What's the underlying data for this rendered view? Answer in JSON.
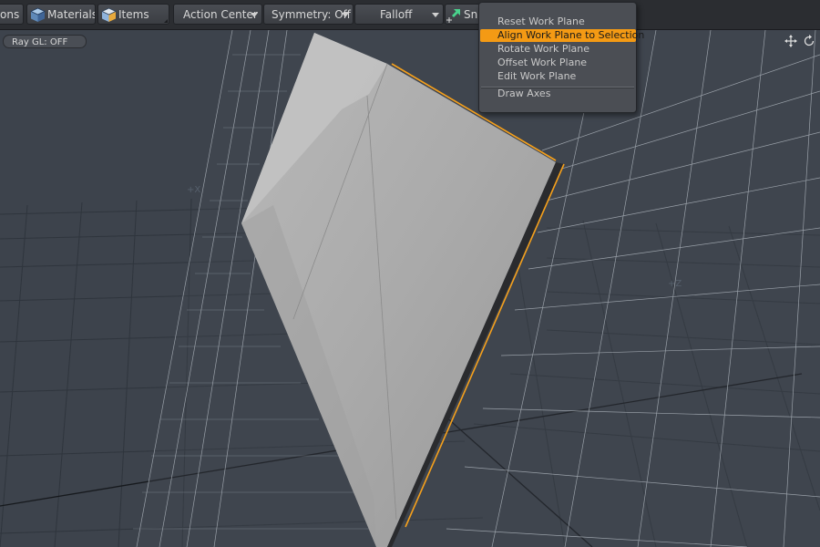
{
  "toolbar": {
    "tab_partial": "ons",
    "materials_label": "Materials",
    "items_label": "Items",
    "action_center_label": "Action Center",
    "symmetry_label": "Symmetry: Off",
    "falloff_label": "Falloff",
    "snap_label_partial": "Sna"
  },
  "viewport": {
    "raygl_label": "Ray GL: OFF",
    "axis_x_label": "+X",
    "axis_z_label": "+Z",
    "icons": [
      "move-view-icon",
      "rotate-view-icon"
    ]
  },
  "workplane_menu": {
    "items": [
      {
        "label": "Reset Work Plane",
        "active": false
      },
      {
        "label": "Align Work Plane to Selection",
        "active": true
      },
      {
        "label": "Rotate Work Plane",
        "active": false
      },
      {
        "label": "Offset Work Plane",
        "active": false
      },
      {
        "label": "Edit Work Plane",
        "active": false
      },
      {
        "label": "Draw Axes",
        "active": false
      }
    ]
  },
  "colors": {
    "highlight": "#f49a14",
    "selection_edge": "#f5a01c",
    "viewport_bg": "#3d434c",
    "grid_line": "#a9b0b8"
  }
}
